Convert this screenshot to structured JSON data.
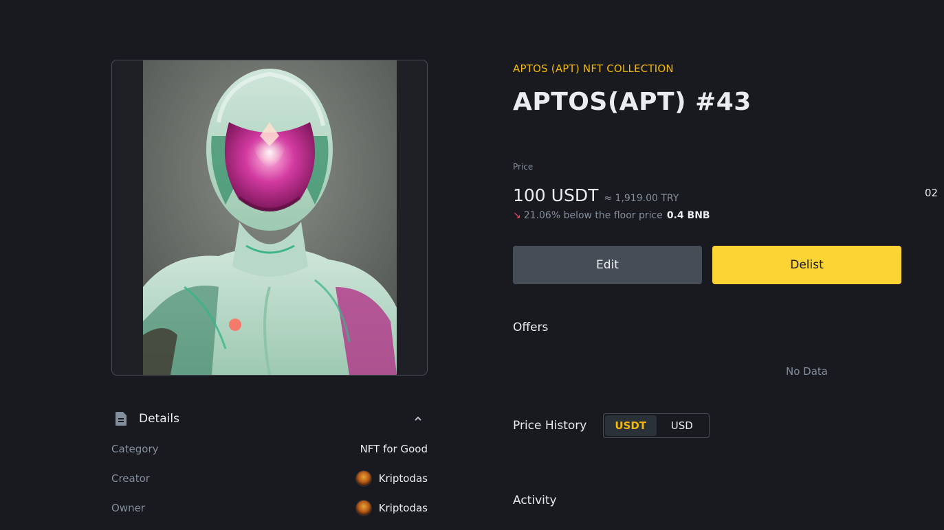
{
  "nft": {
    "collection": "APTOS (APT) NFT COLLECTION",
    "title": "APTOS(APT) #43",
    "image_alt": "Futuristic mint-and-magenta humanoid robot portrait"
  },
  "price": {
    "label": "Price",
    "amount": "100 USDT",
    "fiat": "≈ 1,919.00 TRY",
    "floor_text": "21.06% below the floor price",
    "floor_value": "0.4 BNB",
    "side_number": "02"
  },
  "actions": {
    "edit_label": "Edit",
    "delist_label": "Delist"
  },
  "offers": {
    "title": "Offers",
    "empty": "No Data"
  },
  "price_history": {
    "title": "Price History",
    "options": [
      "USDT",
      "USD"
    ],
    "selected": "USDT"
  },
  "activity": {
    "title": "Activity"
  },
  "details": {
    "title": "Details",
    "rows": [
      {
        "label": "Category",
        "value": "NFT for Good"
      },
      {
        "label": "Creator",
        "value": "Kriptodas"
      },
      {
        "label": "Owner",
        "value": "Kriptodas"
      }
    ]
  },
  "colors": {
    "background": "#181a20",
    "accent": "#f0b90b",
    "delist_button": "#fcd535",
    "edit_button": "#474d57",
    "down": "#f6465d"
  },
  "icons": {
    "details": "document-icon",
    "collapse": "chevron-up-icon",
    "floor_trend": "arrow-down-right-icon"
  }
}
